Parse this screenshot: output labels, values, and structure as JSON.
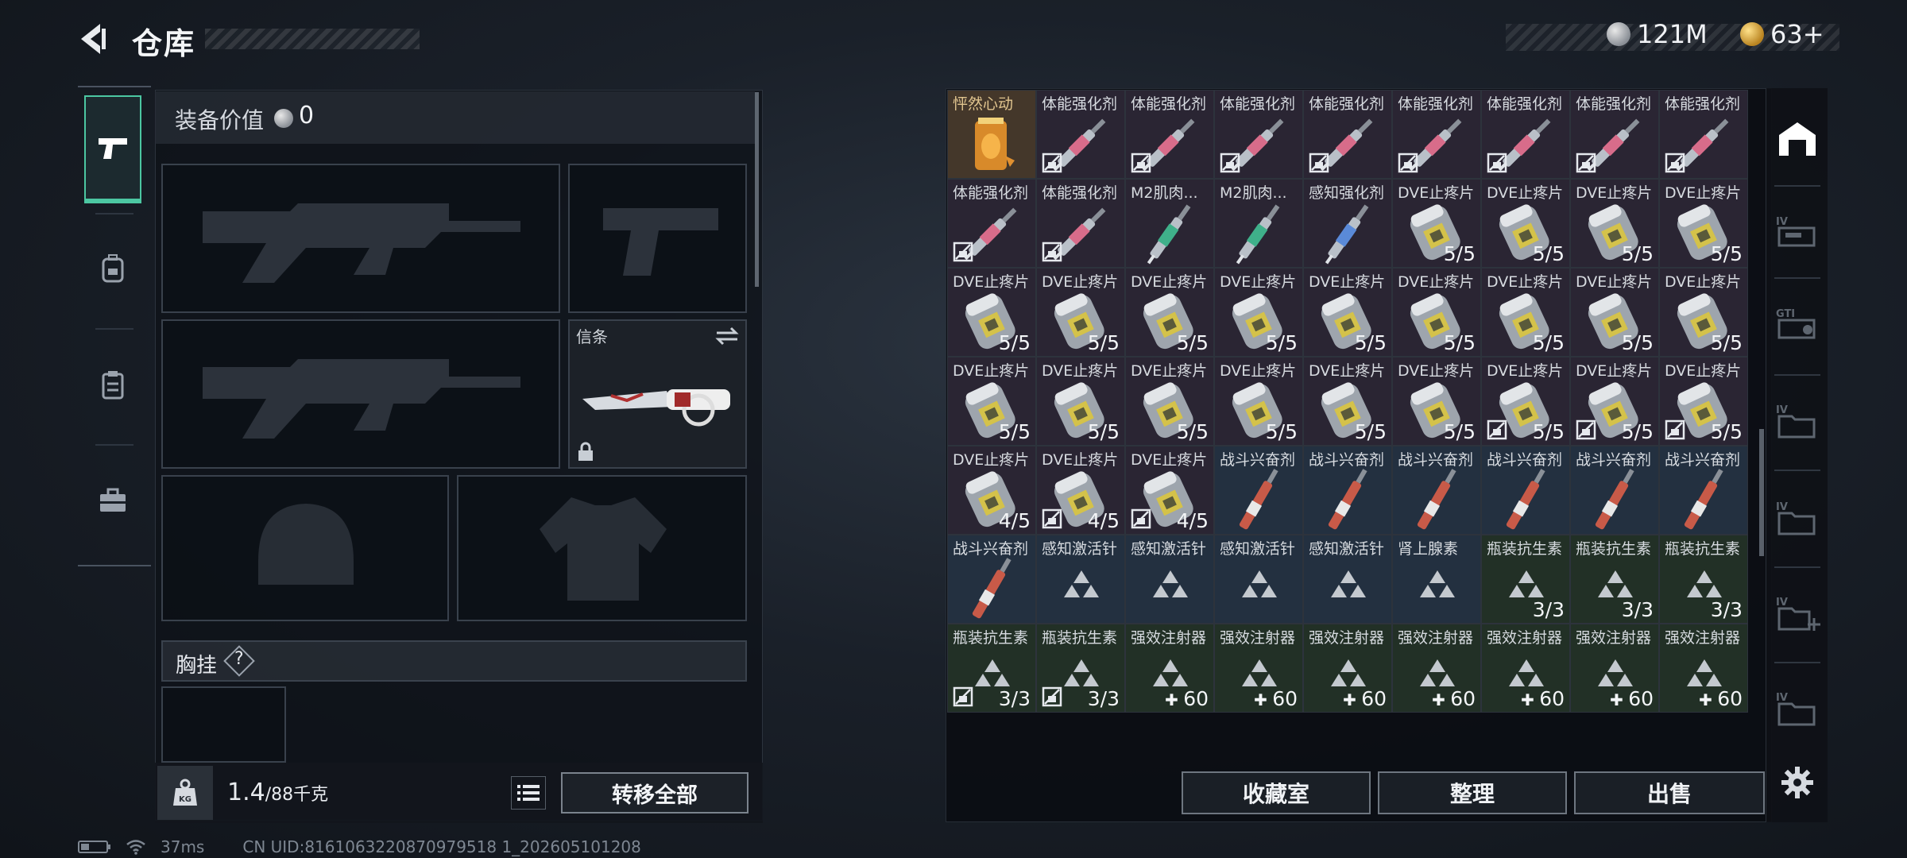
{
  "header": {
    "title": "仓库"
  },
  "currency": {
    "silver": "121M",
    "gold": "63+"
  },
  "equipment": {
    "value_label": "装备价值",
    "value": "0",
    "slot_letter_label": "信条",
    "chest_rig_label": "胸挂",
    "help": "?",
    "weight": "1.4",
    "weight_max": "/88千克",
    "transfer_label": "转移全部"
  },
  "status": {
    "ping": "37ms",
    "uid": "CN UID:8161063220870979518 1_202605101208"
  },
  "buttons": {
    "collection": "收藏室",
    "organize": "整理",
    "sell": "出售"
  },
  "inventory": [
    {
      "name": "怦然心动",
      "qty": "",
      "art": "drink",
      "rarity": "orange",
      "lock": false
    },
    {
      "name": "体能强化剂",
      "qty": "",
      "art": "syringe-pink",
      "rarity": "purple",
      "lock": true
    },
    {
      "name": "体能强化剂",
      "qty": "",
      "art": "syringe-pink",
      "rarity": "purple",
      "lock": true
    },
    {
      "name": "体能强化剂",
      "qty": "",
      "art": "syringe-pink",
      "rarity": "purple",
      "lock": true
    },
    {
      "name": "体能强化剂",
      "qty": "",
      "art": "syringe-pink",
      "rarity": "purple",
      "lock": true
    },
    {
      "name": "体能强化剂",
      "qty": "",
      "art": "syringe-pink",
      "rarity": "purple",
      "lock": true
    },
    {
      "name": "体能强化剂",
      "qty": "",
      "art": "syringe-pink",
      "rarity": "purple",
      "lock": true
    },
    {
      "name": "体能强化剂",
      "qty": "",
      "art": "syringe-pink",
      "rarity": "purple",
      "lock": true
    },
    {
      "name": "体能强化剂",
      "qty": "",
      "art": "syringe-pink",
      "rarity": "purple",
      "lock": true
    },
    {
      "name": "体能强化剂",
      "qty": "",
      "art": "syringe-pink",
      "rarity": "purple",
      "lock": true
    },
    {
      "name": "体能强化剂",
      "qty": "",
      "art": "syringe-pink",
      "rarity": "purple",
      "lock": true
    },
    {
      "name": "M2肌肉...",
      "qty": "",
      "art": "syringe-green",
      "rarity": "purple",
      "lock": false
    },
    {
      "name": "M2肌肉...",
      "qty": "",
      "art": "syringe-green",
      "rarity": "purple",
      "lock": false
    },
    {
      "name": "感知强化剂",
      "qty": "",
      "art": "syringe-blue",
      "rarity": "purple",
      "lock": false
    },
    {
      "name": "DVE止疼片",
      "qty": "5/5",
      "art": "pills",
      "rarity": "purple",
      "lock": false
    },
    {
      "name": "DVE止疼片",
      "qty": "5/5",
      "art": "pills",
      "rarity": "purple",
      "lock": false
    },
    {
      "name": "DVE止疼片",
      "qty": "5/5",
      "art": "pills",
      "rarity": "purple",
      "lock": false
    },
    {
      "name": "DVE止疼片",
      "qty": "5/5",
      "art": "pills",
      "rarity": "purple",
      "lock": false
    },
    {
      "name": "DVE止疼片",
      "qty": "5/5",
      "art": "pills",
      "rarity": "purple",
      "lock": false
    },
    {
      "name": "DVE止疼片",
      "qty": "5/5",
      "art": "pills",
      "rarity": "purple",
      "lock": false
    },
    {
      "name": "DVE止疼片",
      "qty": "5/5",
      "art": "pills",
      "rarity": "purple",
      "lock": false
    },
    {
      "name": "DVE止疼片",
      "qty": "5/5",
      "art": "pills",
      "rarity": "purple",
      "lock": false
    },
    {
      "name": "DVE止疼片",
      "qty": "5/5",
      "art": "pills",
      "rarity": "purple",
      "lock": false
    },
    {
      "name": "DVE止疼片",
      "qty": "5/5",
      "art": "pills",
      "rarity": "purple",
      "lock": false
    },
    {
      "name": "DVE止疼片",
      "qty": "5/5",
      "art": "pills",
      "rarity": "purple",
      "lock": false
    },
    {
      "name": "DVE止疼片",
      "qty": "5/5",
      "art": "pills",
      "rarity": "purple",
      "lock": false
    },
    {
      "name": "DVE止疼片",
      "qty": "5/5",
      "art": "pills",
      "rarity": "purple",
      "lock": false
    },
    {
      "name": "DVE止疼片",
      "qty": "5/5",
      "art": "pills",
      "rarity": "purple",
      "lock": false
    },
    {
      "name": "DVE止疼片",
      "qty": "5/5",
      "art": "pills",
      "rarity": "purple",
      "lock": false
    },
    {
      "name": "DVE止疼片",
      "qty": "5/5",
      "art": "pills",
      "rarity": "purple",
      "lock": false
    },
    {
      "name": "DVE止疼片",
      "qty": "5/5",
      "art": "pills",
      "rarity": "purple",
      "lock": false
    },
    {
      "name": "DVE止疼片",
      "qty": "5/5",
      "art": "pills",
      "rarity": "purple",
      "lock": false
    },
    {
      "name": "DVE止疼片",
      "qty": "5/5",
      "art": "pills",
      "rarity": "purple",
      "lock": false
    },
    {
      "name": "DVE止疼片",
      "qty": "5/5",
      "art": "pills",
      "rarity": "purple",
      "lock": true
    },
    {
      "name": "DVE止疼片",
      "qty": "5/5",
      "art": "pills",
      "rarity": "purple",
      "lock": true
    },
    {
      "name": "DVE止疼片",
      "qty": "5/5",
      "art": "pills",
      "rarity": "purple",
      "lock": true
    },
    {
      "name": "DVE止疼片",
      "qty": "4/5",
      "art": "pills",
      "rarity": "purple",
      "lock": false
    },
    {
      "name": "DVE止疼片",
      "qty": "4/5",
      "art": "pills",
      "rarity": "purple",
      "lock": true
    },
    {
      "name": "DVE止疼片",
      "qty": "4/5",
      "art": "pills",
      "rarity": "purple",
      "lock": true
    },
    {
      "name": "战斗兴奋剂",
      "qty": "",
      "art": "syringe-red",
      "rarity": "blue",
      "lock": false
    },
    {
      "name": "战斗兴奋剂",
      "qty": "",
      "art": "syringe-red",
      "rarity": "blue",
      "lock": false
    },
    {
      "name": "战斗兴奋剂",
      "qty": "",
      "art": "syringe-red",
      "rarity": "blue",
      "lock": false
    },
    {
      "name": "战斗兴奋剂",
      "qty": "",
      "art": "syringe-red",
      "rarity": "blue",
      "lock": false
    },
    {
      "name": "战斗兴奋剂",
      "qty": "",
      "art": "syringe-red",
      "rarity": "blue",
      "lock": false
    },
    {
      "name": "战斗兴奋剂",
      "qty": "",
      "art": "syringe-red",
      "rarity": "blue",
      "lock": false
    },
    {
      "name": "战斗兴奋剂",
      "qty": "",
      "art": "syringe-red",
      "rarity": "blue",
      "lock": false
    },
    {
      "name": "感知激活针",
      "qty": "",
      "art": "unknown",
      "rarity": "blue",
      "lock": false
    },
    {
      "name": "感知激活针",
      "qty": "",
      "art": "unknown",
      "rarity": "blue",
      "lock": false
    },
    {
      "name": "感知激活针",
      "qty": "",
      "art": "unknown",
      "rarity": "blue",
      "lock": false
    },
    {
      "name": "感知激活针",
      "qty": "",
      "art": "unknown",
      "rarity": "blue",
      "lock": false
    },
    {
      "name": "肾上腺素",
      "qty": "",
      "art": "unknown",
      "rarity": "blue",
      "lock": false
    },
    {
      "name": "瓶装抗生素",
      "qty": "3/3",
      "art": "unknown",
      "rarity": "green",
      "lock": false
    },
    {
      "name": "瓶装抗生素",
      "qty": "3/3",
      "art": "unknown",
      "rarity": "green",
      "lock": false
    },
    {
      "name": "瓶装抗生素",
      "qty": "3/3",
      "art": "unknown",
      "rarity": "green",
      "lock": false
    },
    {
      "name": "瓶装抗生素",
      "qty": "3/3",
      "art": "unknown",
      "rarity": "green",
      "lock": true
    },
    {
      "name": "瓶装抗生素",
      "qty": "3/3",
      "art": "unknown",
      "rarity": "green",
      "lock": true
    },
    {
      "name": "强效注射器",
      "qty": "60",
      "art": "unknown",
      "rarity": "green",
      "lock": false,
      "plus": true
    },
    {
      "name": "强效注射器",
      "qty": "60",
      "art": "unknown",
      "rarity": "green",
      "lock": false,
      "plus": true
    },
    {
      "name": "强效注射器",
      "qty": "60",
      "art": "unknown",
      "rarity": "green",
      "lock": false,
      "plus": true
    },
    {
      "name": "强效注射器",
      "qty": "60",
      "art": "unknown",
      "rarity": "green",
      "lock": false,
      "plus": true
    },
    {
      "name": "强效注射器",
      "qty": "60",
      "art": "unknown",
      "rarity": "green",
      "lock": false,
      "plus": true
    },
    {
      "name": "强效注射器",
      "qty": "60",
      "art": "unknown",
      "rarity": "green",
      "lock": false,
      "plus": true
    },
    {
      "name": "强效注射器",
      "qty": "60",
      "art": "unknown",
      "rarity": "green",
      "lock": false,
      "plus": true
    }
  ]
}
